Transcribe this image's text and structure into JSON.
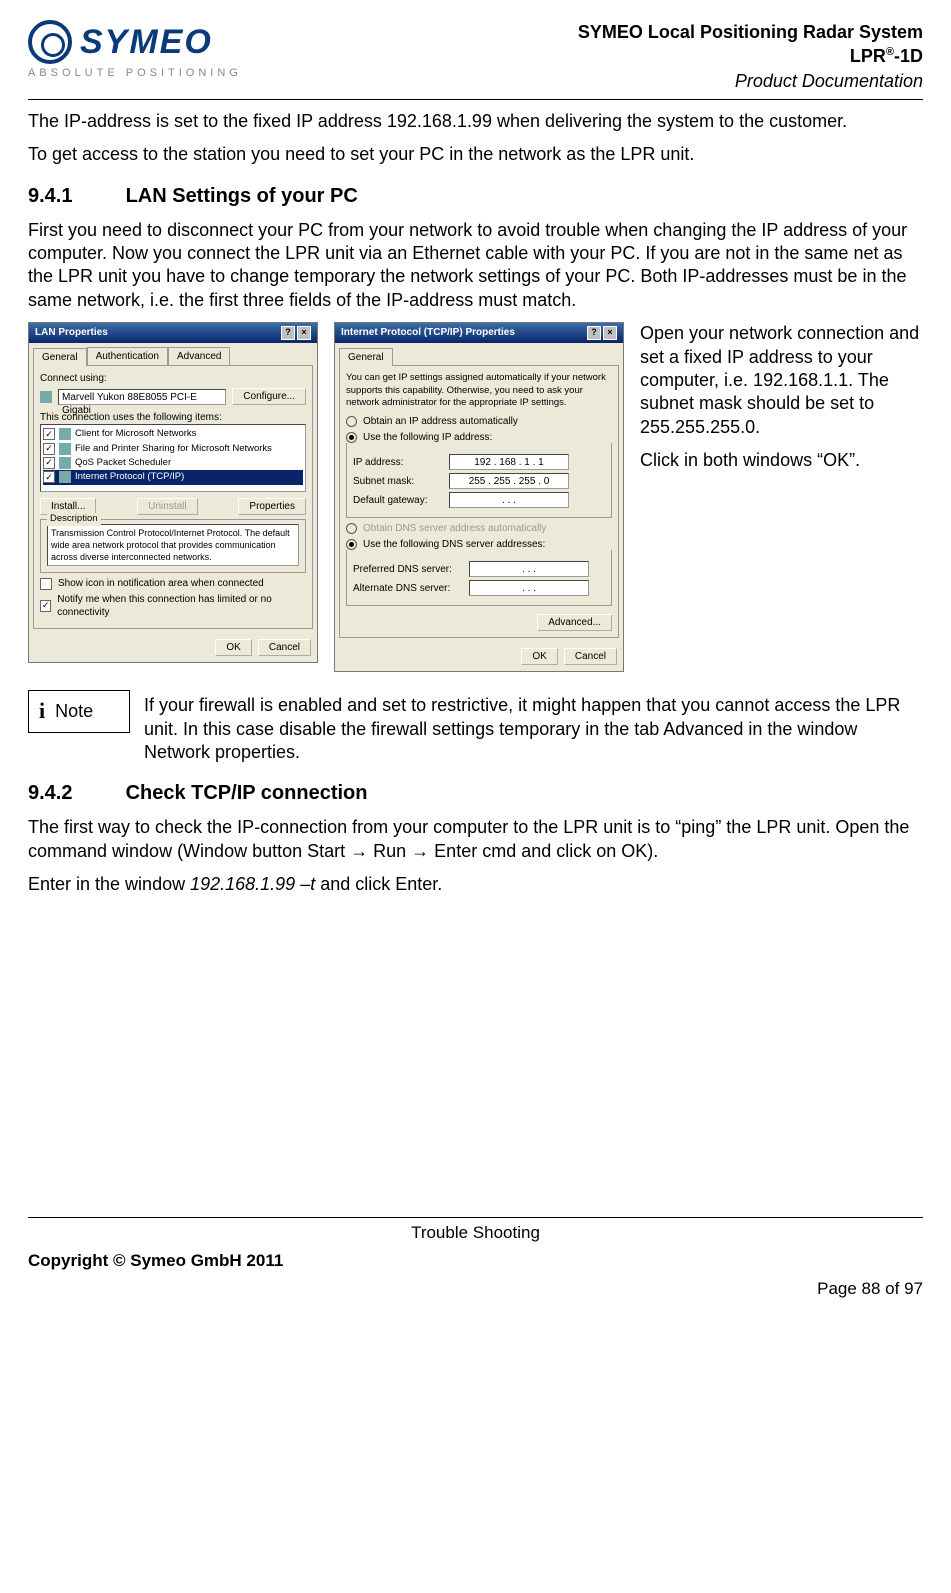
{
  "header": {
    "logo_text": "SYMEO",
    "logo_sub": "ABSOLUTE POSITIONING",
    "title_line1": "SYMEO Local Positioning Radar System",
    "title_line2_prefix": "LPR",
    "title_line2_sup": "®",
    "title_line2_suffix": "-1D",
    "title_line3": "Product Documentation"
  },
  "intro_p1": "The IP-address is set to the fixed IP address 192.168.1.99 when delivering the system to the customer.",
  "intro_p2": "To get access to the station you need to set your PC in the network as the LPR unit.",
  "section941": {
    "num": "9.4.1",
    "title": "LAN Settings of your PC",
    "para": "First you need to disconnect your PC from your network to avoid trouble when changing the IP address of your computer. Now you connect the LPR unit via an Ethernet cable with your PC. If you are not in the same net as the LPR unit you have to change temporary the network settings of your PC. Both IP-addresses must be in the same network, i.e. the first three fields of the IP-address must match."
  },
  "lan_dialog": {
    "title": "LAN Properties",
    "tabs": [
      "General",
      "Authentication",
      "Advanced"
    ],
    "connect_label": "Connect using:",
    "adapter": "Marvell Yukon 88E8055 PCI-E Gigabi",
    "configure": "Configure...",
    "items_label": "This connection uses the following items:",
    "items": [
      "Client for Microsoft Networks",
      "File and Printer Sharing for Microsoft Networks",
      "QoS Packet Scheduler",
      "Internet Protocol (TCP/IP)"
    ],
    "install": "Install...",
    "uninstall": "Uninstall",
    "properties": "Properties",
    "desc_label": "Description",
    "desc": "Transmission Control Protocol/Internet Protocol. The default wide area network protocol that provides communication across diverse interconnected networks.",
    "show_icon": "Show icon in notification area when connected",
    "notify": "Notify me when this connection has limited or no connectivity",
    "ok": "OK",
    "cancel": "Cancel"
  },
  "tcpip_dialog": {
    "title": "Internet Protocol (TCP/IP) Properties",
    "tab": "General",
    "intro": "You can get IP settings assigned automatically if your network supports this capability. Otherwise, you need to ask your network administrator for the appropriate IP settings.",
    "obtain_auto": "Obtain an IP address automatically",
    "use_following": "Use the following IP address:",
    "ip_label": "IP address:",
    "ip_value": "192 . 168 .   1  .   1",
    "subnet_label": "Subnet mask:",
    "subnet_value": "255 . 255 . 255 .   0",
    "gateway_label": "Default gateway:",
    "gateway_value": " .     .     . ",
    "dns_auto": "Obtain DNS server address automatically",
    "dns_use": "Use the following DNS server addresses:",
    "pref_dns": "Preferred DNS server:",
    "alt_dns": "Alternate DNS server:",
    "advanced": "Advanced...",
    "ok": "OK",
    "cancel": "Cancel"
  },
  "side": {
    "p1": "Open your network connection and set a fixed IP address to your computer, i.e. 192.168.1.1. The subnet mask should be set to 255.255.255.0.",
    "p2": "Click in both windows “OK”."
  },
  "note": {
    "icon": "i",
    "label": "Note",
    "text": "If your firewall is enabled and set to restrictive, it might happen that you cannot access the LPR unit. In this case disable the firewall settings temporary in the tab Advanced in the window Network properties."
  },
  "section942": {
    "num": "9.4.2",
    "title": "Check TCP/IP connection",
    "para1_a": "The first way to check the IP-connection from your computer to the LPR unit is to “ping” the LPR unit. Open the command window (Window button Start ",
    "para1_b": " Run ",
    "para1_c": " Enter cmd and click on OK).",
    "para2_a": "Enter in the window ",
    "para2_italic": "192.168.1.99 –t",
    "para2_b": " and click Enter."
  },
  "footer": {
    "center": "Trouble Shooting",
    "copyright": "Copyright © Symeo GmbH 2011",
    "page": "Page 88 of 97"
  }
}
